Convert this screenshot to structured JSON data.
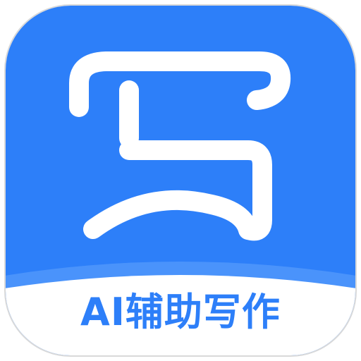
{
  "app_icon": {
    "glyph_icon": "handwritten-xie-glyph-icon",
    "caption": "AI辅助写作"
  },
  "colors": {
    "tile_blue": "#2d7ff9",
    "tile_border": "#d9d9d9",
    "glyph": "#ffffff",
    "panel": "#ffffff",
    "caption_text": "#2d7ff9"
  }
}
